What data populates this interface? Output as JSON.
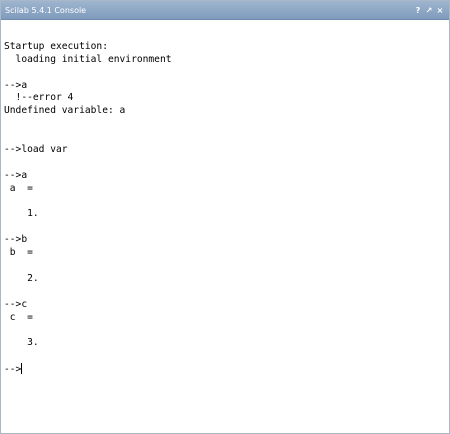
{
  "window": {
    "title": "Scilab 5.4.1 Console",
    "buttons": {
      "help": "?",
      "undock": "↗",
      "close": "×"
    }
  },
  "console": {
    "lines": [
      "",
      "Startup execution:",
      "  loading initial environment",
      "",
      "-->a",
      "  !--error 4",
      "Undefined variable: a",
      "",
      "",
      "-->load var",
      "",
      "-->a",
      " a  =",
      "",
      "    1.",
      "",
      "-->b",
      " b  =",
      "",
      "    2.",
      "",
      "-->c",
      " c  =",
      "",
      "    3.",
      "",
      "-->"
    ]
  }
}
